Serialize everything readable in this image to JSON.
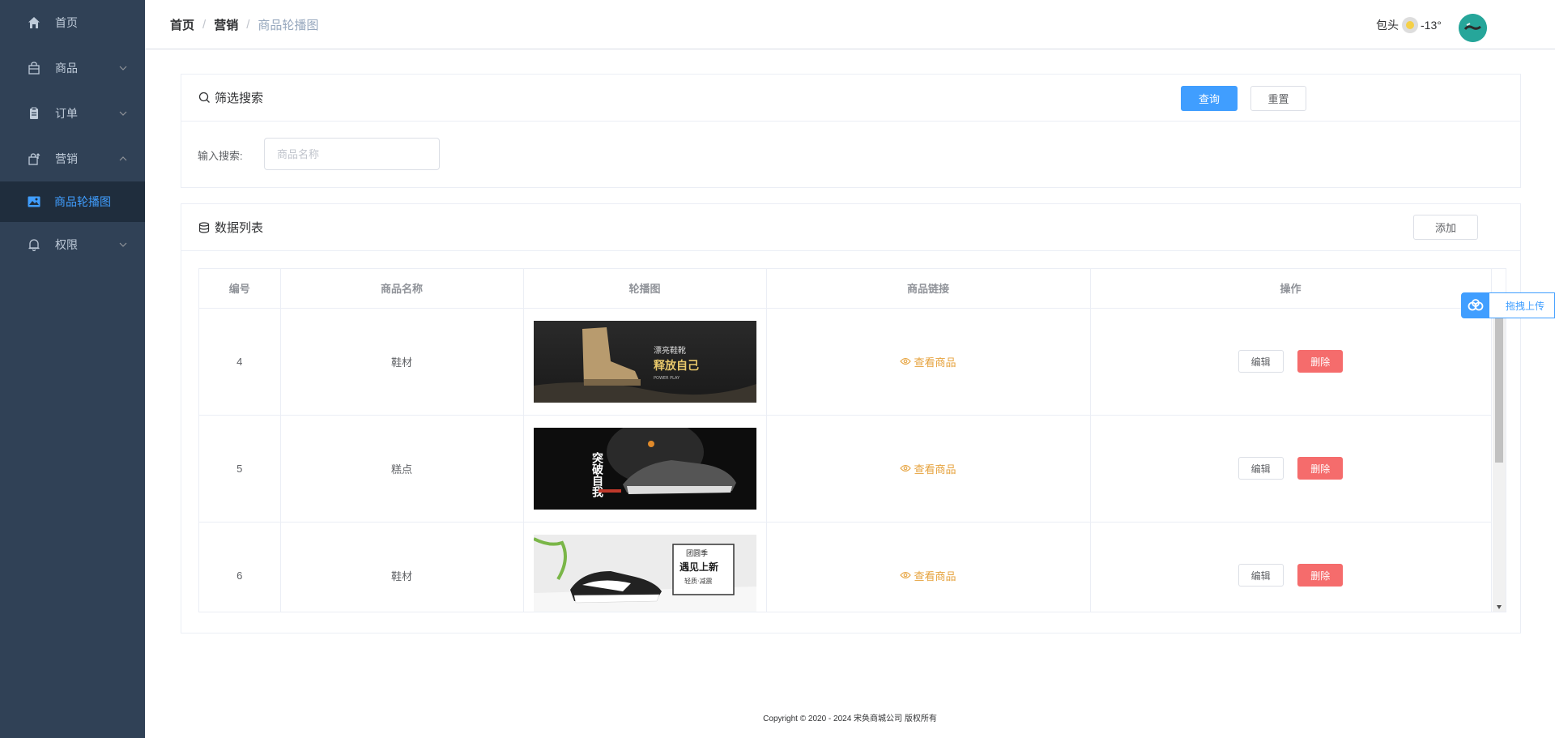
{
  "sidebar": {
    "items": [
      {
        "label": "首页"
      },
      {
        "label": "商品"
      },
      {
        "label": "订单"
      },
      {
        "label": "营销"
      },
      {
        "label": "商品轮播图"
      },
      {
        "label": "权限"
      }
    ]
  },
  "header": {
    "breadcrumb": [
      "首页",
      "营销",
      "商品轮播图"
    ],
    "breadcrumb_sep": "/",
    "weather_city": "包头",
    "weather_temp": "-13°"
  },
  "filter": {
    "title": "筛选搜索",
    "query_label": "查询",
    "reset_label": "重置",
    "input_label": "输入搜索:",
    "input_placeholder": "商品名称",
    "input_value": ""
  },
  "list": {
    "title": "数据列表",
    "add_label": "添加",
    "columns": [
      "编号",
      "商品名称",
      "轮播图",
      "商品链接",
      "操作"
    ],
    "rows": [
      {
        "id": "4",
        "name": "鞋材",
        "link": "查看商品",
        "edit": "编辑",
        "delete": "删除"
      },
      {
        "id": "5",
        "name": "糕点",
        "link": "查看商品",
        "edit": "编辑",
        "delete": "删除"
      },
      {
        "id": "6",
        "name": "鞋材",
        "link": "查看商品",
        "edit": "编辑",
        "delete": "删除"
      }
    ],
    "banners": [
      {
        "line1": "漂亮鞋靴",
        "line2": "释放自己",
        "line3": "POWER PLAY"
      },
      {
        "line1": "突破自我"
      },
      {
        "line1": "团圆季",
        "line2": "遇见上新",
        "line3": "轻质·减震"
      }
    ]
  },
  "upload": {
    "label": "拖拽上传"
  },
  "footer": {
    "copyright": "Copyright © 2020 - 2024 宋奂商城公司 版权所有"
  },
  "colors": {
    "sidebar_bg": "#304156",
    "primary": "#409eff",
    "danger": "#f56c6c",
    "warning": "#e6a23c"
  }
}
